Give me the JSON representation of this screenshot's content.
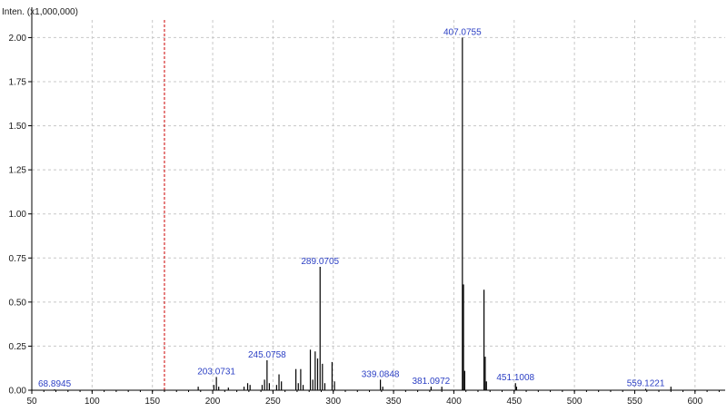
{
  "chart_data": {
    "type": "bar",
    "ylabel": "Inten. (x1,000,000)",
    "xlim": [
      50,
      625
    ],
    "ylim": [
      0,
      2.1
    ],
    "x_ticks": [
      50,
      100,
      150,
      200,
      250,
      300,
      350,
      400,
      450,
      500,
      550,
      600
    ],
    "y_ticks": [
      0.0,
      0.25,
      0.5,
      0.75,
      1.0,
      1.25,
      1.5,
      1.75,
      2.0
    ],
    "y_tick_labels": [
      "0.00",
      "0.25",
      "0.50",
      "0.75",
      "1.00",
      "1.25",
      "1.50",
      "1.75",
      "2.00"
    ],
    "grid": true,
    "marker_line_x": 160,
    "colors": {
      "peaks": "#000000",
      "labels": "#2b3fc4",
      "grid": "#c8c8c8",
      "marker": "#cc0000"
    },
    "peaks": [
      {
        "x": 68.8945,
        "y": 0.005,
        "label": "68.8945"
      },
      {
        "x": 188.0,
        "y": 0.02
      },
      {
        "x": 201.0,
        "y": 0.03
      },
      {
        "x": 203.0731,
        "y": 0.075,
        "label": "203.0731"
      },
      {
        "x": 205.0,
        "y": 0.02
      },
      {
        "x": 213.0,
        "y": 0.015
      },
      {
        "x": 226.0,
        "y": 0.02
      },
      {
        "x": 229.0,
        "y": 0.04
      },
      {
        "x": 231.0,
        "y": 0.03
      },
      {
        "x": 241.0,
        "y": 0.03
      },
      {
        "x": 243.0,
        "y": 0.06
      },
      {
        "x": 245.0758,
        "y": 0.17,
        "label": "245.0758"
      },
      {
        "x": 247.0,
        "y": 0.04
      },
      {
        "x": 253.0,
        "y": 0.03
      },
      {
        "x": 255.0,
        "y": 0.09
      },
      {
        "x": 257.0,
        "y": 0.05
      },
      {
        "x": 269.0,
        "y": 0.12
      },
      {
        "x": 271.0,
        "y": 0.04
      },
      {
        "x": 273.0,
        "y": 0.12
      },
      {
        "x": 275.0,
        "y": 0.03
      },
      {
        "x": 281.0,
        "y": 0.23
      },
      {
        "x": 283.0,
        "y": 0.06
      },
      {
        "x": 285.0,
        "y": 0.22
      },
      {
        "x": 287.0,
        "y": 0.18
      },
      {
        "x": 289.0705,
        "y": 0.7,
        "label": "289.0705"
      },
      {
        "x": 291.0,
        "y": 0.15
      },
      {
        "x": 293.0,
        "y": 0.04
      },
      {
        "x": 299.0,
        "y": 0.16
      },
      {
        "x": 301.0,
        "y": 0.05
      },
      {
        "x": 339.0848,
        "y": 0.06,
        "label": "339.0848"
      },
      {
        "x": 341.0,
        "y": 0.02
      },
      {
        "x": 381.0972,
        "y": 0.02,
        "label": "381.0972"
      },
      {
        "x": 390.0,
        "y": 0.02
      },
      {
        "x": 407.0755,
        "y": 2.0,
        "label": "407.0755"
      },
      {
        "x": 408.0,
        "y": 0.6
      },
      {
        "x": 409.0,
        "y": 0.11
      },
      {
        "x": 425.0,
        "y": 0.57
      },
      {
        "x": 426.0,
        "y": 0.19
      },
      {
        "x": 427.0,
        "y": 0.05
      },
      {
        "x": 451.1008,
        "y": 0.04,
        "label": "451.1008"
      },
      {
        "x": 452.0,
        "y": 0.02
      },
      {
        "x": 559.1221,
        "y": 0.008,
        "label": "559.1221"
      },
      {
        "x": 580.0,
        "y": 0.02
      }
    ]
  }
}
